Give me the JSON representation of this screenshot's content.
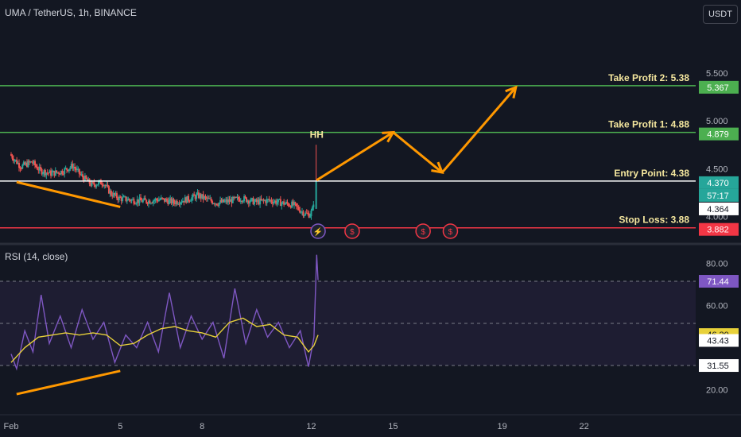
{
  "header": {
    "symbol_title": "UMA / TetherUS, 1h, BINANCE",
    "currency_button": "USDT"
  },
  "rsi": {
    "title": "RSI (14, close)"
  },
  "colors": {
    "background": "#131722",
    "up_candle": "#26a69a",
    "down_candle": "#ef5350",
    "take_profit_line": "#4caf50",
    "entry_line": "#ffffff",
    "stop_loss_line": "#f23645",
    "annotation_orange": "#ff9800",
    "annotation_text": "#f5e79e",
    "rsi_line": "#7e57c2",
    "rsi_ma_line": "#e8d13a",
    "rsi_band": "#7e57c2"
  },
  "chart_data": [
    {
      "type": "candlestick",
      "symbol": "UMA / TetherUS",
      "timeframe": "1h",
      "exchange": "BINANCE",
      "x_tick_labels": [
        "Feb",
        "5",
        "8",
        "12",
        "15",
        "19",
        "22"
      ],
      "x_tick_days": [
        1,
        5,
        8,
        12,
        15,
        19,
        22
      ],
      "xlim_days": [
        1,
        26.5
      ],
      "y_tick_labels": [
        "5.500",
        "5.000",
        "4.500",
        "4.000"
      ],
      "y_ticks": [
        5.5,
        5.0,
        4.5,
        4.0
      ],
      "ylim": [
        3.73,
        5.98
      ],
      "price_path": [
        [
          1.0,
          4.65
        ],
        [
          1.4,
          4.52
        ],
        [
          1.8,
          4.57
        ],
        [
          2.1,
          4.48
        ],
        [
          2.5,
          4.45
        ],
        [
          2.9,
          4.47
        ],
        [
          3.3,
          4.53
        ],
        [
          3.6,
          4.43
        ],
        [
          4.0,
          4.33
        ],
        [
          4.4,
          4.36
        ],
        [
          4.7,
          4.24
        ],
        [
          5.0,
          4.19
        ],
        [
          5.5,
          4.17
        ],
        [
          6.0,
          4.16
        ],
        [
          6.5,
          4.18
        ],
        [
          7.0,
          4.15
        ],
        [
          7.5,
          4.18
        ],
        [
          7.9,
          4.22
        ],
        [
          8.3,
          4.17
        ],
        [
          8.6,
          4.14
        ],
        [
          9.0,
          4.16
        ],
        [
          9.5,
          4.19
        ],
        [
          10.0,
          4.15
        ],
        [
          10.5,
          4.17
        ],
        [
          11.0,
          4.14
        ],
        [
          11.4,
          4.12
        ],
        [
          11.8,
          4.03
        ],
        [
          12.0,
          4.02
        ],
        [
          12.1,
          4.08
        ],
        [
          12.2,
          4.37
        ]
      ],
      "last_price": "4.370",
      "countdown": "57:17",
      "price_tag": "4.364",
      "levels": [
        {
          "label": "Take Profit 2: 5.38",
          "value": 5.367,
          "tag": "5.367",
          "color": "#4caf50"
        },
        {
          "label": "Take Profit 1: 4.88",
          "value": 4.879,
          "tag": "4.879",
          "color": "#4caf50"
        },
        {
          "label": "Entry Point: 4.38",
          "value": 4.37,
          "tag": "4.370",
          "color": "#ffffff"
        },
        {
          "label": "Stop Loss: 3.88",
          "value": 3.882,
          "tag": "3.882",
          "color": "#f23645"
        }
      ],
      "annotations": {
        "swing_label": "HH",
        "projection_path": [
          [
            12.2,
            4.38
          ],
          [
            15.0,
            4.88
          ],
          [
            16.8,
            4.46
          ],
          [
            19.5,
            5.35
          ]
        ],
        "trend_line": [
          [
            1.2,
            4.36
          ],
          [
            5.0,
            4.1
          ]
        ]
      }
    },
    {
      "type": "line",
      "title": "RSI (14, close)",
      "y_tick_labels": [
        "80.00",
        "60.00",
        "20.00"
      ],
      "y_ticks": [
        80,
        60,
        20
      ],
      "ylim": [
        12,
        88
      ],
      "band": [
        31.55,
        71.44
      ],
      "series": [
        {
          "values": [
            [
              1.0,
              37
            ],
            [
              1.2,
              30
            ],
            [
              1.5,
              48
            ],
            [
              1.8,
              38
            ],
            [
              2.1,
              65
            ],
            [
              2.4,
              42
            ],
            [
              2.8,
              55
            ],
            [
              3.2,
              40
            ],
            [
              3.6,
              58
            ],
            [
              4.0,
              44
            ],
            [
              4.4,
              52
            ],
            [
              4.8,
              33
            ],
            [
              5.2,
              46
            ],
            [
              5.6,
              40
            ],
            [
              6.0,
              52
            ],
            [
              6.4,
              38
            ],
            [
              6.8,
              66
            ],
            [
              7.2,
              40
            ],
            [
              7.6,
              55
            ],
            [
              8.0,
              44
            ],
            [
              8.4,
              52
            ],
            [
              8.8,
              35
            ],
            [
              9.2,
              68
            ],
            [
              9.6,
              42
            ],
            [
              10.0,
              58
            ],
            [
              10.4,
              45
            ],
            [
              10.8,
              52
            ],
            [
              11.2,
              40
            ],
            [
              11.6,
              48
            ],
            [
              11.9,
              31
            ],
            [
              12.1,
              45
            ],
            [
              12.2,
              84
            ],
            [
              12.25,
              72
            ]
          ]
        },
        {
          "values": [
            [
              1.0,
              33
            ],
            [
              1.5,
              40
            ],
            [
              2.0,
              45
            ],
            [
              2.5,
              46
            ],
            [
              3.0,
              47
            ],
            [
              3.5,
              46
            ],
            [
              4.0,
              47
            ],
            [
              4.5,
              46
            ],
            [
              5.0,
              41
            ],
            [
              5.5,
              42
            ],
            [
              6.0,
              46
            ],
            [
              6.5,
              49
            ],
            [
              7.0,
              50
            ],
            [
              7.5,
              48
            ],
            [
              8.0,
              47
            ],
            [
              8.5,
              45
            ],
            [
              9.0,
              52
            ],
            [
              9.5,
              54
            ],
            [
              10.0,
              50
            ],
            [
              10.5,
              51
            ],
            [
              11.0,
              46
            ],
            [
              11.5,
              45
            ],
            [
              11.9,
              38
            ],
            [
              12.1,
              41
            ],
            [
              12.25,
              46
            ]
          ]
        }
      ],
      "last_values": [
        {
          "tag": "71.44",
          "value": 71.44,
          "color": "#7e57c2"
        },
        {
          "tag": "46.20",
          "value": 46.2,
          "color": "#e8d13a"
        },
        {
          "tag": "43.43",
          "value": 43.43,
          "color": "#ffffff"
        },
        {
          "tag": "31.55",
          "value": 31.55,
          "color": "#ffffff"
        }
      ],
      "annotations": {
        "trend_line": [
          [
            1.2,
            18
          ],
          [
            5.0,
            29
          ]
        ]
      }
    }
  ]
}
